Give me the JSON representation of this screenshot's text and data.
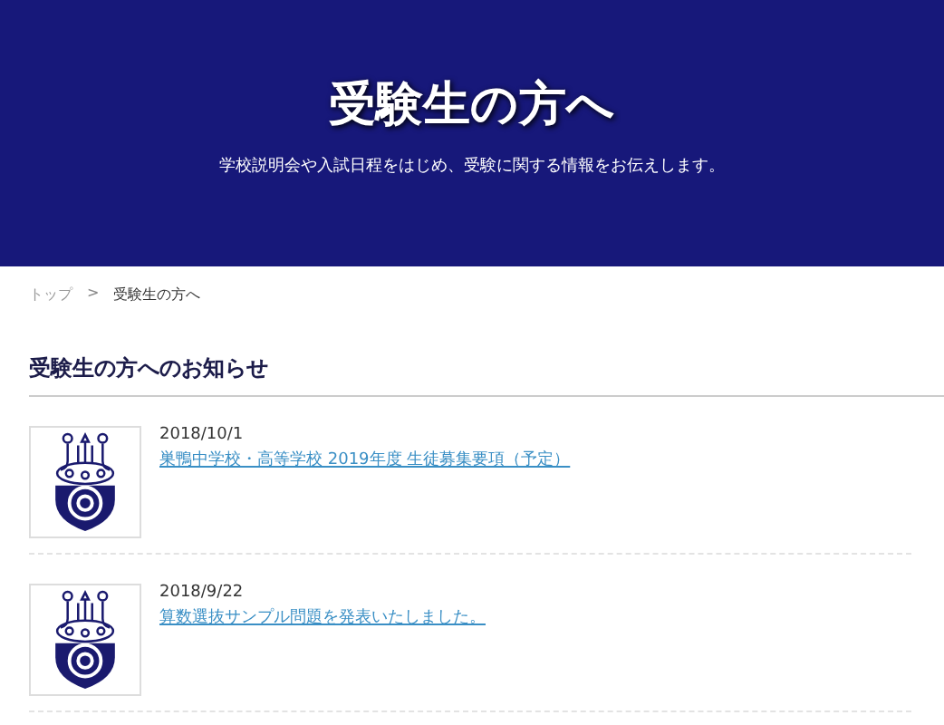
{
  "hero": {
    "title": "受験生の方へ",
    "subtitle": "学校説明会や入試日程をはじめ、受験に関する情報をお伝えします。"
  },
  "breadcrumb": [
    "トップ",
    ">",
    "受験生の方へ"
  ],
  "section": {
    "title": "受験生の方へのお知らせ"
  },
  "news": [
    {
      "date": "2018/10/1",
      "title": "巣鴨中学校・高等学校 2019年度 生徒募集要項（予定）"
    },
    {
      "date": "2018/9/22",
      "title": "算数選抜サンプル問題を発表いたしました。"
    }
  ]
}
